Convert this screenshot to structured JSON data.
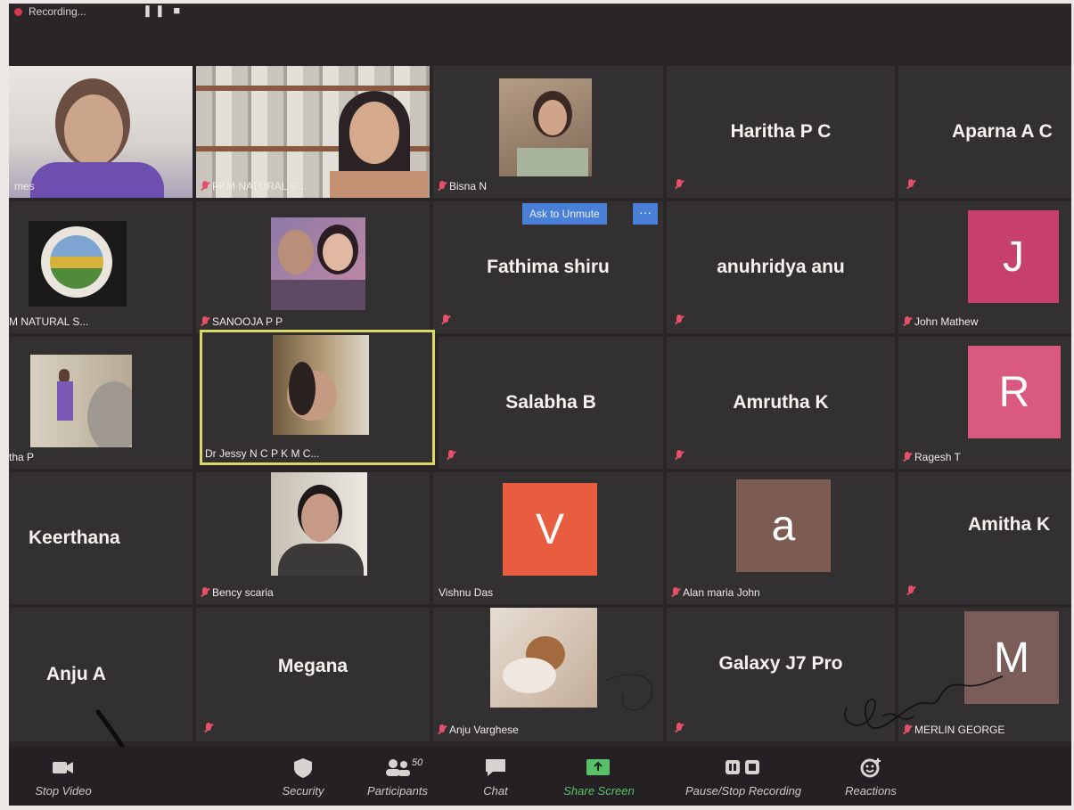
{
  "topbar": {
    "recording_label": "Recording..."
  },
  "grid": {
    "row1": [
      {
        "label": "mes",
        "type": "video"
      },
      {
        "label": "PKM NATURAL S...",
        "type": "video"
      },
      {
        "label": "Bisna N",
        "type": "video"
      },
      {
        "name": "Haritha P C",
        "type": "name"
      },
      {
        "name": "Aparna A C",
        "type": "name"
      }
    ],
    "row2": [
      {
        "label": "M NATURAL S...",
        "type": "logo"
      },
      {
        "label": "SANOOJA P P",
        "type": "video"
      },
      {
        "name": "Fathima shiru",
        "type": "name"
      },
      {
        "name": "anuhridya anu",
        "type": "name"
      },
      {
        "label": "John Mathew",
        "initial": "J",
        "color": "#c7406c",
        "type": "avatar"
      }
    ],
    "row3": [
      {
        "label": "tha P",
        "type": "video"
      },
      {
        "label": "Dr Jessy N C P K M C...",
        "type": "video",
        "active": true
      },
      {
        "name": "Salabha B",
        "type": "name"
      },
      {
        "name": "Amrutha K",
        "type": "name"
      },
      {
        "label": "Ragesh T",
        "initial": "R",
        "color": "#d95a7e",
        "type": "avatar"
      }
    ],
    "row4": [
      {
        "name": "Keerthana",
        "type": "name"
      },
      {
        "label": "Bency scaria",
        "type": "video"
      },
      {
        "label": "Vishnu Das",
        "initial": "V",
        "color": "#e85c3f",
        "type": "avatar"
      },
      {
        "label": "Alan maria John",
        "initial": "a",
        "color": "#7c5b52",
        "type": "avatar"
      },
      {
        "name": "Amitha K",
        "type": "name"
      }
    ],
    "row5": [
      {
        "name": "Anju A",
        "type": "name"
      },
      {
        "name": "Megana",
        "type": "name"
      },
      {
        "label": "Anju Varghese",
        "type": "video"
      },
      {
        "name": "Galaxy J7 Pro",
        "type": "name"
      },
      {
        "label": "MERLIN GEORGE",
        "initial": "M",
        "color": "#7a5d58",
        "type": "avatar"
      }
    ]
  },
  "ask_to_unmute": "Ask to Unmute",
  "ask_more": "···",
  "toolbar": {
    "stop_video": "Stop Video",
    "security": "Security",
    "participants": "Participants",
    "participants_count": "50",
    "chat": "Chat",
    "share_screen": "Share Screen",
    "pause_stop_recording": "Pause/Stop Recording",
    "reactions": "Reactions"
  },
  "colors": {
    "background": "#2a2527",
    "tile": "#333032",
    "active_border": "#d9d86a",
    "accent_blue": "#4a7fd8",
    "share_green": "#58c06a",
    "muted_red": "#e6506a"
  }
}
